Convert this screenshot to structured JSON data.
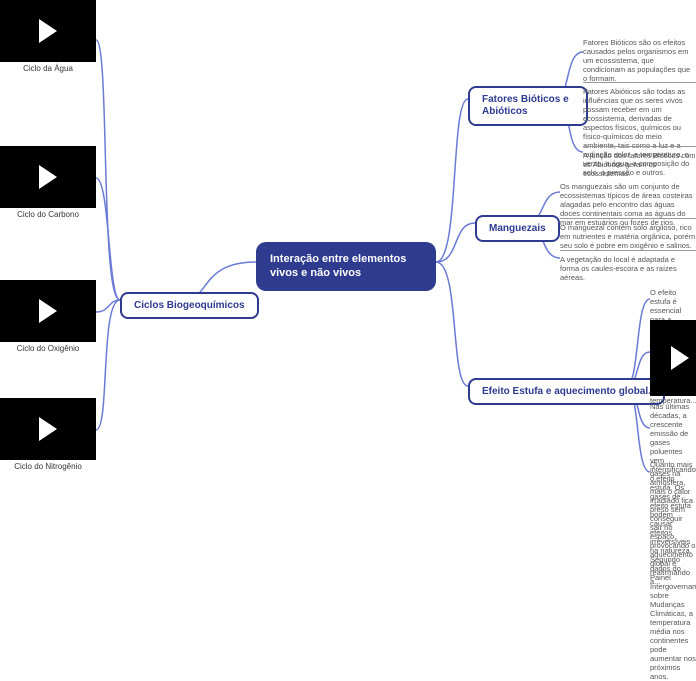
{
  "central": {
    "title": "Interação entre elementos vivos e não vivos"
  },
  "branches": {
    "ciclos": {
      "label": "Ciclos Biogeoquímicos"
    },
    "fatores": {
      "label": "Fatores Bióticos e Abióticos"
    },
    "manguezais": {
      "label": "Manguezais"
    },
    "efeito": {
      "label": "Efeito Estufa e aquecimento global."
    }
  },
  "videos": {
    "agua": {
      "caption": "Ciclo da Água"
    },
    "carbono": {
      "caption": "Ciclo do Carbono"
    },
    "oxigenio": {
      "caption": "Ciclo do Oxigênio"
    },
    "nitrogenio": {
      "caption": "Ciclo do Nitrogênio"
    }
  },
  "texts": {
    "fatores_bioticos": "Fatores Bióticos são os efeitos causados pelos organismos em um ecossistema, que condicionam as populações que o formam.",
    "fatores_abioticos": "Fatores Abióticos são todas as influências que os seres vivos possam receber em um ecossistema, derivadas de aspectos físicos, químicos ou físico-químicos do meio ambiente, tais como a luz e a radiação solar, a temperatura, o vento, a água, a composição do solo, a pressão e outros.",
    "juncao": "A junção dos fatores Bióticos com os Abióticos geram os ecossistemas.",
    "manguezais_1": "Os manguezais são um conjunto de ecossistemas típicos de áreas costeiras alagadas pelo encontro das águas doces continentais coma as águas do mar em estuários ou fozes de rios.",
    "manguezais_2": "O manguezal contém solo argiloso, rico em nutrientes e matéria orgânica, porém seu solo é pobre em oxigênio e salinos.",
    "manguezais_3": "A vegetação do local  é adaptada e forma os caules-escora e as raízes aéreas.",
    "efeito_1": "O efeito estufa é essencial para a manutenção da vida, pois mantém a atmosfera terrestre aquecida, garantindo uma temperatura...",
    "efeito_2": "Nas últimas décadas, a crescente emissão de gases poluentes vem intensificando o efeito estufa. Os gases de efeito estufa podem causar efeitos irreversíveis na natureza. Segundo dados do Painel Intergovernamental sobre Mudanças Climáticas, a temperatura média nos continentes pode aumentar nos próximos anos.",
    "efeito_3": "Quanto mais gases na atmosfera, mais o calor irradiado fica preso sem conseguir sair no espaço, provocando o aquecimento global e reafirmando a..."
  }
}
